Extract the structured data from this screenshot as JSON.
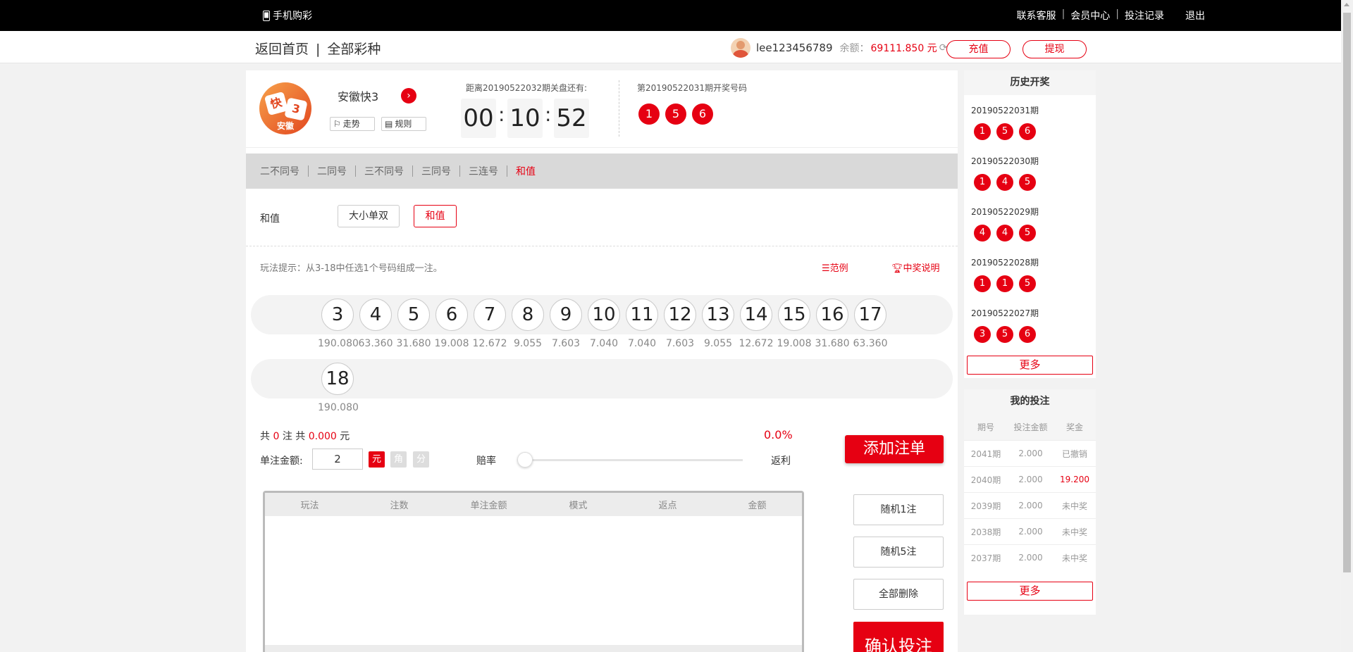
{
  "topbar": {
    "mobile": "手机购彩",
    "links": [
      "联系客服",
      "会员中心",
      "投注记录",
      "退出"
    ]
  },
  "subbar": {
    "home": "返回首页",
    "separator": "|",
    "all": "全部彩种"
  },
  "user": {
    "name": "lee123456789",
    "balance_label": "余额：",
    "balance": "69111.850 元",
    "recharge": "充值",
    "withdraw": "提现"
  },
  "lottery": {
    "logo_text": "安徽",
    "logo_mark": "快3",
    "name": "安徽快3",
    "trend": "走势",
    "rules": "规则",
    "countdown_label": "距离20190522032期关盘还有:",
    "hh": "00",
    "mm": "10",
    "ss": "52",
    "open_label": "第20190522031期开奖号码",
    "open_balls": [
      "1",
      "5",
      "6"
    ]
  },
  "tabs": [
    {
      "label": "二不同号",
      "active": false
    },
    {
      "label": "二同号",
      "active": false
    },
    {
      "label": "三不同号",
      "active": false
    },
    {
      "label": "三同号",
      "active": false
    },
    {
      "label": "三连号",
      "active": false
    },
    {
      "label": "和值",
      "active": true
    }
  ],
  "subplay": {
    "label": "和值",
    "chips": [
      {
        "label": "大小单双",
        "selected": false
      },
      {
        "label": "和值",
        "selected": true
      }
    ]
  },
  "hint": {
    "text": "玩法提示：从3-18中任选1个号码组成一注。",
    "example": "范例",
    "prize": "中奖说明"
  },
  "numbers": [
    {
      "n": "3",
      "odds": "190.080"
    },
    {
      "n": "4",
      "odds": "63.360"
    },
    {
      "n": "5",
      "odds": "31.680"
    },
    {
      "n": "6",
      "odds": "19.008"
    },
    {
      "n": "7",
      "odds": "12.672"
    },
    {
      "n": "8",
      "odds": "9.055"
    },
    {
      "n": "9",
      "odds": "7.603"
    },
    {
      "n": "10",
      "odds": "7.040"
    },
    {
      "n": "11",
      "odds": "7.040"
    },
    {
      "n": "12",
      "odds": "7.603"
    },
    {
      "n": "13",
      "odds": "9.055"
    },
    {
      "n": "14",
      "odds": "12.672"
    },
    {
      "n": "15",
      "odds": "19.008"
    },
    {
      "n": "16",
      "odds": "31.680"
    },
    {
      "n": "17",
      "odds": "63.360"
    },
    {
      "n": "18",
      "odds": "190.080"
    }
  ],
  "summary": {
    "p1": "共 ",
    "count": "0",
    "p2": " 注 共 ",
    "amount": "0.000",
    "p3": " 元",
    "pct": "0.0%",
    "amount_label": "单注金额:",
    "amount_value": "2",
    "units": [
      "元",
      "角",
      "分"
    ],
    "odds_label": "赔率",
    "rebate_label": "返利",
    "add": "添加注单"
  },
  "order_table": {
    "headers": [
      "玩法",
      "注数",
      "单注金额",
      "模式",
      "返点",
      "金额"
    ]
  },
  "actions": {
    "random1": "随机1注",
    "random5": "随机5注",
    "clear": "全部删除",
    "confirm": "确认投注"
  },
  "history": {
    "title": "历史开奖",
    "items": [
      {
        "period": "20190522031期",
        "balls": [
          "1",
          "5",
          "6"
        ]
      },
      {
        "period": "20190522030期",
        "balls": [
          "1",
          "4",
          "5"
        ]
      },
      {
        "period": "20190522029期",
        "balls": [
          "4",
          "4",
          "5"
        ]
      },
      {
        "period": "20190522028期",
        "balls": [
          "1",
          "1",
          "5"
        ]
      },
      {
        "period": "20190522027期",
        "balls": [
          "3",
          "5",
          "6"
        ]
      }
    ],
    "more": "更多"
  },
  "mybets": {
    "title": "我的投注",
    "headers": [
      "期号",
      "投注金额",
      "奖金"
    ],
    "rows": [
      {
        "period": "2041期",
        "amount": "2.000",
        "prize": "已撤销",
        "win": false
      },
      {
        "period": "2040期",
        "amount": "2.000",
        "prize": "19.200",
        "win": true
      },
      {
        "period": "2039期",
        "amount": "2.000",
        "prize": "未中奖",
        "win": false
      },
      {
        "period": "2038期",
        "amount": "2.000",
        "prize": "未中奖",
        "win": false
      },
      {
        "period": "2037期",
        "amount": "2.000",
        "prize": "未中奖",
        "win": false
      }
    ],
    "more": "更多"
  },
  "colors": {
    "accent": "#e60012",
    "topbar": "#000000"
  }
}
